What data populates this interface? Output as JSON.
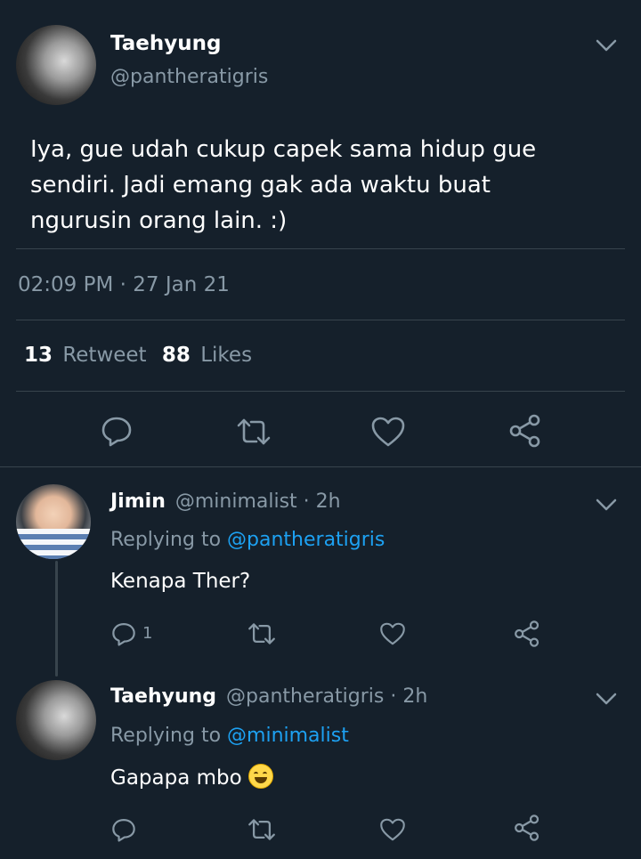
{
  "main_tweet": {
    "display_name": "Taehyung",
    "handle": "@pantheratigris",
    "text_lines": [
      "Iya, gue udah cukup capek sama hidup gue",
      "sendiri. Jadi emang gak ada waktu buat",
      "ngurusin orang lain. :)"
    ],
    "timestamp": "02:09 PM · 27 Jan 21",
    "retweet_count": "13",
    "retweet_label": "Retweet",
    "like_count": "88",
    "like_label": "Likes"
  },
  "replies": [
    {
      "display_name": "Jimin",
      "handle_time": "@minimalist · 2h",
      "replying_prefix": "Replying to",
      "replying_handle": "@pantheratigris",
      "text": "Kenapa Ther?",
      "reply_count": "1"
    },
    {
      "display_name": "Taehyung",
      "handle_time": "@pantheratigris · 2h",
      "replying_prefix": "Replying to",
      "replying_handle": "@minimalist",
      "text": "Gapapa mbo",
      "emoji": "grinning-sweat-emoji"
    }
  ],
  "icons": [
    "chevron-down-icon",
    "reply-icon",
    "retweet-icon",
    "like-icon",
    "share-icon"
  ],
  "colors": {
    "background": "#15202b",
    "muted": "#8899a6",
    "link": "#1da1f2",
    "divider": "#38444d"
  }
}
